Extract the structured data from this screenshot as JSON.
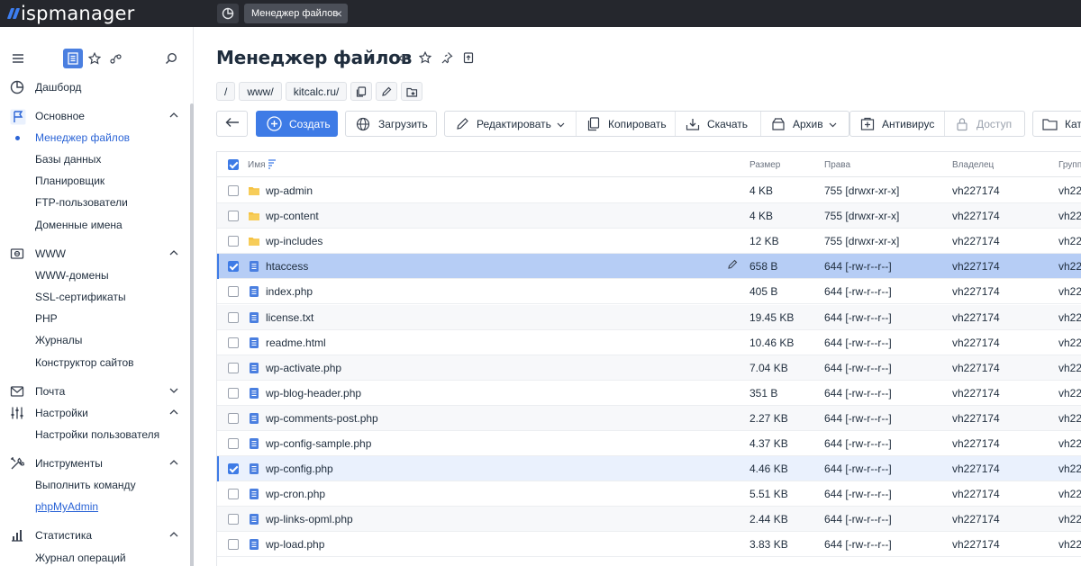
{
  "app": {
    "logo_text": "ispmanager",
    "brand_color": "#3d7ef0",
    "accent": "#3e7be6"
  },
  "topbar": {
    "home_icon": "dashboard-icon",
    "tab_label": "Менеджер файлов"
  },
  "sidebar": {
    "tools": [
      "menu-icon",
      "list-icon",
      "star-icon",
      "wave-icon",
      "search-icon"
    ],
    "items": [
      {
        "label": "Дашборд",
        "icon": "dashboard-icon",
        "type": "section"
      },
      {
        "label": "Основное",
        "icon": "flag-icon",
        "type": "group",
        "expanded": true
      },
      {
        "label": "Менеджер файлов",
        "type": "sub",
        "current": true
      },
      {
        "label": "Базы данных",
        "type": "sub"
      },
      {
        "label": "Планировщик",
        "type": "sub"
      },
      {
        "label": "FTP-пользователи",
        "type": "sub"
      },
      {
        "label": "Доменные имена",
        "type": "sub"
      },
      {
        "label": "WWW",
        "icon": "globe-icon",
        "type": "group",
        "expanded": true
      },
      {
        "label": "WWW-домены",
        "type": "sub"
      },
      {
        "label": "SSL-сертификаты",
        "type": "sub"
      },
      {
        "label": "PHP",
        "type": "sub"
      },
      {
        "label": "Журналы",
        "type": "sub"
      },
      {
        "label": "Конструктор сайтов",
        "type": "sub"
      },
      {
        "label": "Почта",
        "icon": "mail-icon",
        "type": "group",
        "expanded": false
      },
      {
        "label": "Настройки",
        "icon": "sliders-icon",
        "type": "group",
        "expanded": true
      },
      {
        "label": "Настройки пользователя",
        "type": "sub"
      },
      {
        "label": "Инструменты",
        "icon": "tools-icon",
        "type": "group",
        "expanded": true
      },
      {
        "label": "Выполнить команду",
        "type": "sub"
      },
      {
        "label": "phpMyAdmin",
        "type": "sub",
        "link": true
      },
      {
        "label": "Статистика",
        "icon": "stats-icon",
        "type": "group",
        "expanded": true
      },
      {
        "label": "Журнал операций",
        "type": "sub"
      }
    ]
  },
  "main": {
    "title": "Менеджер файлов",
    "title_icons": [
      "link-icon",
      "star-icon",
      "pin-icon",
      "export-icon"
    ],
    "breadcrumbs": [
      "/",
      "www/",
      "kitcalc.ru/"
    ],
    "breadcrumb_icons": [
      "copy-icon",
      "pencil-icon",
      "bookmark-icon"
    ],
    "toolbar": {
      "back": "arrow-left-icon",
      "create": "Создать",
      "upload": "Загрузить",
      "edit": "Редактировать",
      "copy": "Копировать",
      "download": "Скачать",
      "archive": "Архив",
      "antivirus": "Антивирус",
      "access": "Доступ",
      "catalog": "Ката"
    },
    "table": {
      "columns": {
        "name": "Имя",
        "size": "Размер",
        "rights": "Права",
        "owner": "Владелец",
        "group": "Групп"
      },
      "rows": [
        {
          "name": "wp-admin",
          "type": "folder",
          "size": "4 KB",
          "rights": "755 [drwxr-xr-x]",
          "owner": "vh227174",
          "group": "vh22",
          "checked": false,
          "state": ""
        },
        {
          "name": "wp-content",
          "type": "folder",
          "size": "4 KB",
          "rights": "755 [drwxr-xr-x]",
          "owner": "vh227174",
          "group": "vh22",
          "checked": false,
          "state": ""
        },
        {
          "name": "wp-includes",
          "type": "folder",
          "size": "12 KB",
          "rights": "755 [drwxr-xr-x]",
          "owner": "vh227174",
          "group": "vh22",
          "checked": false,
          "state": ""
        },
        {
          "name": "htaccess",
          "type": "file",
          "size": "658 B",
          "rights": "644 [-rw-r--r--]",
          "owner": "vh227174",
          "group": "vh22",
          "checked": true,
          "state": "selected"
        },
        {
          "name": "index.php",
          "type": "file",
          "size": "405 B",
          "rights": "644 [-rw-r--r--]",
          "owner": "vh227174",
          "group": "vh22",
          "checked": false,
          "state": ""
        },
        {
          "name": "license.txt",
          "type": "file",
          "size": "19.45 KB",
          "rights": "644 [-rw-r--r--]",
          "owner": "vh227174",
          "group": "vh22",
          "checked": false,
          "state": ""
        },
        {
          "name": "readme.html",
          "type": "file",
          "size": "10.46 KB",
          "rights": "644 [-rw-r--r--]",
          "owner": "vh227174",
          "group": "vh22",
          "checked": false,
          "state": ""
        },
        {
          "name": "wp-activate.php",
          "type": "file",
          "size": "7.04 KB",
          "rights": "644 [-rw-r--r--]",
          "owner": "vh227174",
          "group": "vh22",
          "checked": false,
          "state": ""
        },
        {
          "name": "wp-blog-header.php",
          "type": "file",
          "size": "351 B",
          "rights": "644 [-rw-r--r--]",
          "owner": "vh227174",
          "group": "vh22",
          "checked": false,
          "state": ""
        },
        {
          "name": "wp-comments-post.php",
          "type": "file",
          "size": "2.27 KB",
          "rights": "644 [-rw-r--r--]",
          "owner": "vh227174",
          "group": "vh22",
          "checked": false,
          "state": ""
        },
        {
          "name": "wp-config-sample.php",
          "type": "file",
          "size": "4.37 KB",
          "rights": "644 [-rw-r--r--]",
          "owner": "vh227174",
          "group": "vh22",
          "checked": false,
          "state": ""
        },
        {
          "name": "wp-config.php",
          "type": "file",
          "size": "4.46 KB",
          "rights": "644 [-rw-r--r--]",
          "owner": "vh227174",
          "group": "vh22",
          "checked": true,
          "state": "checked"
        },
        {
          "name": "wp-cron.php",
          "type": "file",
          "size": "5.51 KB",
          "rights": "644 [-rw-r--r--]",
          "owner": "vh227174",
          "group": "vh22",
          "checked": false,
          "state": ""
        },
        {
          "name": "wp-links-opml.php",
          "type": "file",
          "size": "2.44 KB",
          "rights": "644 [-rw-r--r--]",
          "owner": "vh227174",
          "group": "vh22",
          "checked": false,
          "state": ""
        },
        {
          "name": "wp-load.php",
          "type": "file",
          "size": "3.83 KB",
          "rights": "644 [-rw-r--r--]",
          "owner": "vh227174",
          "group": "vh22",
          "checked": false,
          "state": ""
        }
      ]
    }
  }
}
